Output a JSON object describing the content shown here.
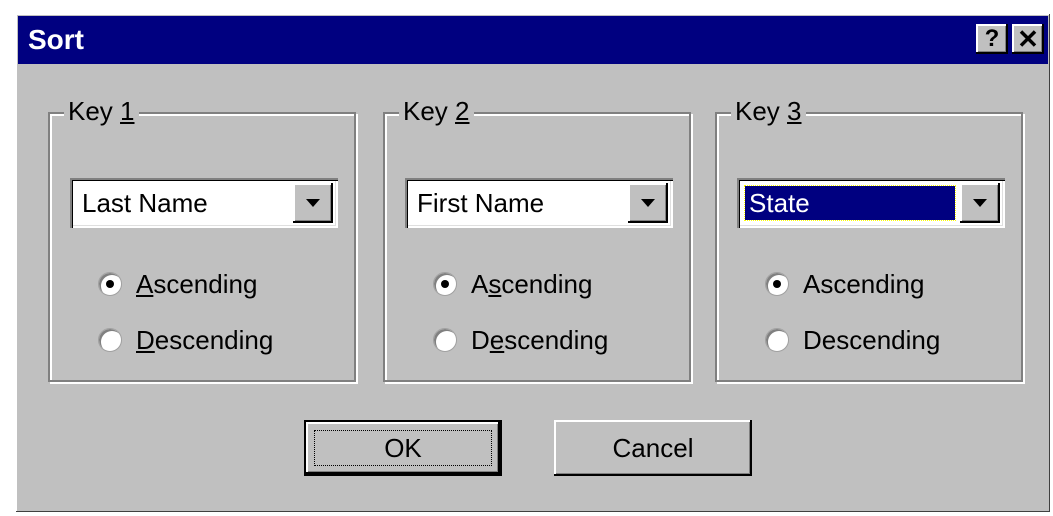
{
  "window": {
    "title": "Sort",
    "help_glyph": "?",
    "close_glyph": "✕"
  },
  "groups": [
    {
      "label_prefix": "Key ",
      "label_access": "1",
      "selected_field": "Last Name",
      "ascending_pre": "",
      "ascending_key": "A",
      "ascending_post": "scending",
      "descending_pre": "",
      "descending_key": "D",
      "descending_post": "escending",
      "sort_order": "ascending"
    },
    {
      "label_prefix": "Key ",
      "label_access": "2",
      "selected_field": "First Name",
      "ascending_pre": "A",
      "ascending_key": "s",
      "ascending_post": "cending",
      "descending_pre": "D",
      "descending_key": "e",
      "descending_post": "scending",
      "sort_order": "ascending"
    },
    {
      "label_prefix": "Key ",
      "label_access": "3",
      "selected_field": "State",
      "ascending_pre": "Ascendin",
      "ascending_key": "g",
      "ascending_post": "",
      "descending_pre": "Descendin",
      "descending_key": "g",
      "descending_post": "",
      "sort_order": "ascending"
    }
  ],
  "buttons": {
    "ok_label": "OK",
    "cancel_label": "Cancel"
  },
  "colors": {
    "titlebar": "#000080",
    "dialog_face": "#c0c0c0",
    "selection": "#000080"
  },
  "icons": [
    "help-icon",
    "close-icon",
    "dropdown-arrow-icon"
  ]
}
